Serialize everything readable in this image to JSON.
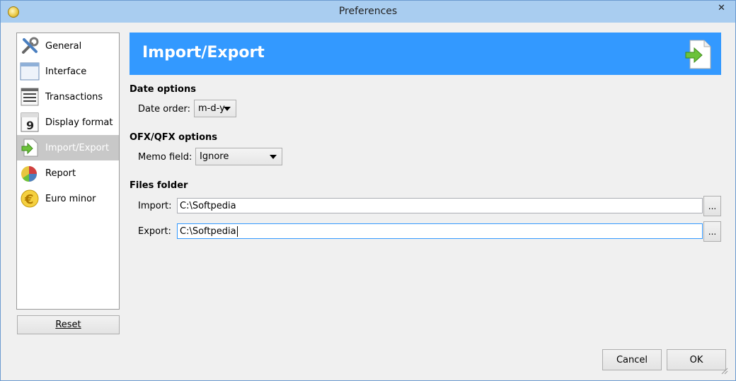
{
  "window": {
    "title": "Preferences",
    "close_glyph": "✕",
    "icon": "app-icon"
  },
  "sidebar": {
    "items": [
      {
        "label": "General",
        "icon": "tools-icon"
      },
      {
        "label": "Interface",
        "icon": "window-icon"
      },
      {
        "label": "Transactions",
        "icon": "list-icon"
      },
      {
        "label": "Display format",
        "icon": "calendar-icon"
      },
      {
        "label": "Import/Export",
        "icon": "import-export-icon",
        "selected": true
      },
      {
        "label": "Report",
        "icon": "pie-chart-icon"
      },
      {
        "label": "Euro minor",
        "icon": "euro-icon"
      }
    ],
    "reset_label": "Reset"
  },
  "banner": {
    "title": "Import/Export",
    "icon": "import-export-icon"
  },
  "date_options": {
    "title": "Date options",
    "date_order_label": "Date order:",
    "date_order_value": "m-d-y"
  },
  "ofx_options": {
    "title": "OFX/QFX options",
    "memo_label": "Memo field:",
    "memo_value": "Ignore"
  },
  "files_folder": {
    "title": "Files folder",
    "import_label": "Import:",
    "import_value": "C:\\Softpedia",
    "export_label": "Export:",
    "export_value": "C:\\Softpedia",
    "browse_label": "..."
  },
  "buttons": {
    "cancel": "Cancel",
    "ok": "OK"
  },
  "colors": {
    "accent": "#3399ff",
    "selected_bg": "#c8c8c8"
  }
}
